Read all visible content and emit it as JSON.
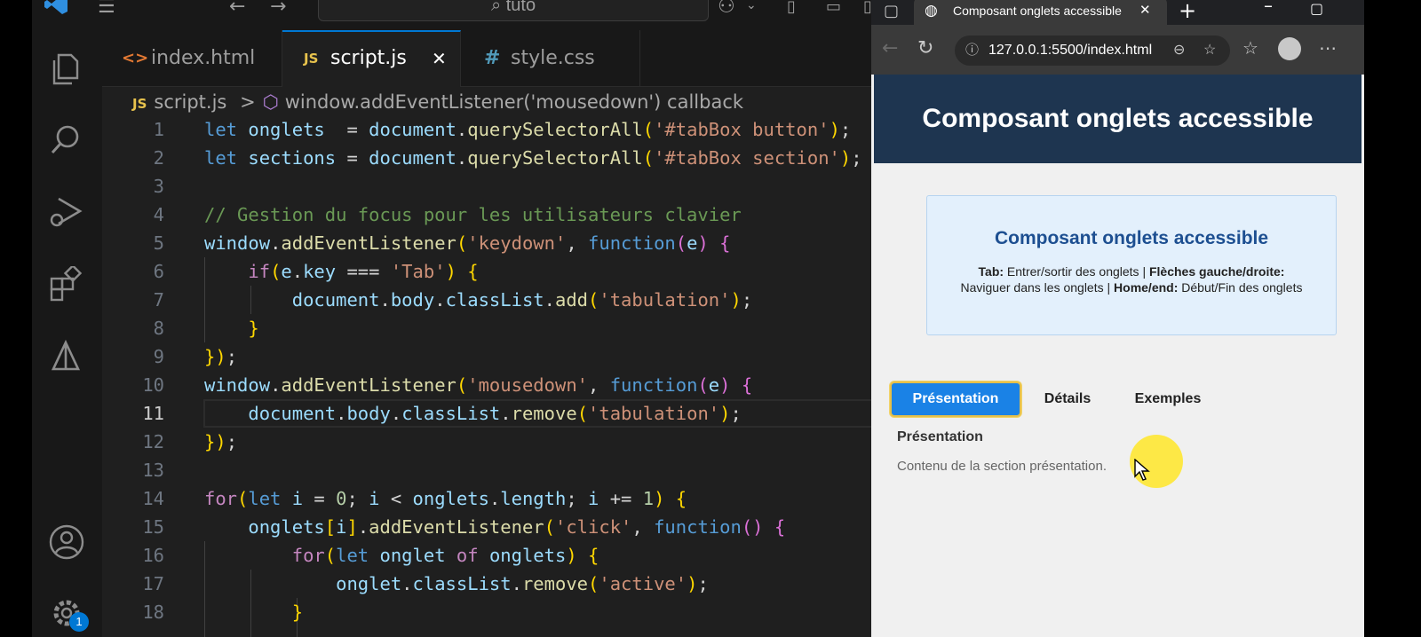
{
  "vscode": {
    "search_text": "tuto",
    "tabs": [
      {
        "icon": "<>",
        "label": "index.html"
      },
      {
        "icon": "JS",
        "label": "script.js",
        "close": "✕"
      },
      {
        "icon": "#",
        "label": "style.css"
      }
    ],
    "breadcrumb": {
      "file_icon": "JS",
      "file": "script.js",
      "sep": ">",
      "symbol": "window.addEventListener('mousedown') callback"
    },
    "active_line": 11,
    "line_numbers": [
      "1",
      "2",
      "3",
      "4",
      "5",
      "6",
      "7",
      "8",
      "9",
      "10",
      "11",
      "12",
      "13",
      "14",
      "15",
      "16",
      "17",
      "18"
    ],
    "code_lines": [
      "let onglets  = document.querySelectorAll('#tabBox button');",
      "let sections = document.querySelectorAll('#tabBox section');",
      "",
      "// Gestion du focus pour les utilisateurs clavier",
      "window.addEventListener('keydown', function(e) {",
      "    if(e.key === 'Tab') {",
      "        document.body.classList.add('tabulation');",
      "    }",
      "});",
      "window.addEventListener('mousedown', function(e) {",
      "    document.body.classList.remove('tabulation');",
      "});",
      "",
      "for(let i = 0; i < onglets.length; i += 1) {",
      "    onglets[i].addEventListener('click', function() {",
      "        for(let onglet of onglets) {",
      "            onglet.classList.remove('active');",
      "        }"
    ],
    "notification_badge": "1"
  },
  "browser": {
    "tab_title": "Composant onglets accessible",
    "tab_close": "✕",
    "new_tab": "+",
    "url": "127.0.0.1:5500/index.html",
    "page": {
      "header_title": "Composant onglets accessible",
      "info_title": "Composant onglets accessible",
      "info_parts": [
        {
          "bold": "Tab:",
          "text": " Entrer/sortir des onglets | "
        },
        {
          "bold": "Flèches gauche/droite:",
          "text": " Naviguer dans les onglets | "
        },
        {
          "bold": "Home/end:",
          "text": " Début/Fin des onglets"
        }
      ],
      "tabs": [
        "Présentation",
        "Détails",
        "Exemples"
      ],
      "active_tab": "Présentation",
      "section_title": "Présentation",
      "section_text": "Contenu de la section présentation."
    }
  },
  "colors": {
    "vscode_bg": "#1f1f1f",
    "accent": "#0078d4",
    "page_header_bg": "#1e3550",
    "active_tab_bg": "#1a82e6",
    "focus_ring": "#e6c04a",
    "cursor_highlight": "#ffe628"
  }
}
